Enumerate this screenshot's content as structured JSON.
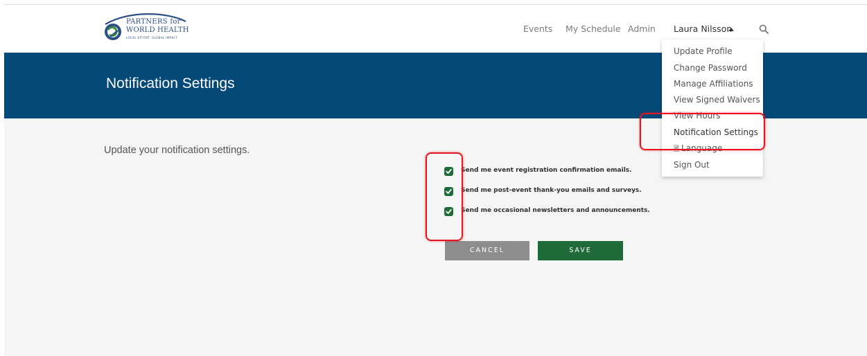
{
  "brand": {
    "line1": "PARTNERS for",
    "line2": "WORLD HEALTH",
    "tagline": "LOCAL EFFORT. GLOBAL IMPACT",
    "color": "#2b4f86"
  },
  "nav": {
    "events": "Events",
    "my_schedule": "My Schedule",
    "admin": "Admin",
    "user_name": "Laura Nilsson"
  },
  "banner": {
    "title": "Notification Settings",
    "color": "#054979"
  },
  "user_menu": {
    "items": [
      {
        "label": "Update Profile"
      },
      {
        "label": "Change Password"
      },
      {
        "label": "Manage Affiliations"
      },
      {
        "label": "View Signed Waivers"
      },
      {
        "label": "View Hours"
      },
      {
        "label": "Notification Settings"
      },
      {
        "label": "Language"
      },
      {
        "label": "Sign Out"
      }
    ]
  },
  "main": {
    "intro": "Update your notification settings.",
    "options": [
      {
        "label": "Send me event registration confirmation emails.",
        "checked": true
      },
      {
        "label": "Send me post-event thank-you emails and surveys.",
        "checked": true
      },
      {
        "label": "Send me occasional newsletters and announcements.",
        "checked": true
      }
    ],
    "cancel_label": "CANCEL",
    "save_label": "SAVE"
  },
  "colors": {
    "accent_green": "#1f6b3a",
    "highlight": "#e8141d"
  }
}
